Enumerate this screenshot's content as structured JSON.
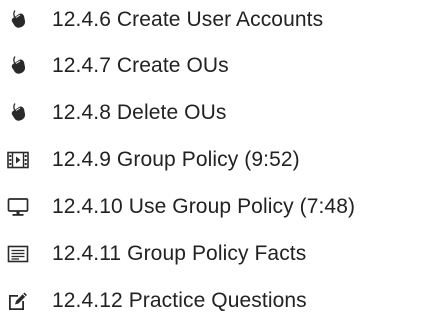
{
  "items": [
    {
      "label": "12.4.6 Create User Accounts",
      "icon": "mouse-icon"
    },
    {
      "label": "12.4.7 Create OUs",
      "icon": "mouse-icon"
    },
    {
      "label": "12.4.8 Delete OUs",
      "icon": "mouse-icon"
    },
    {
      "label": "12.4.9 Group Policy (9:52)",
      "icon": "film-icon"
    },
    {
      "label": "12.4.10 Use Group Policy (7:48)",
      "icon": "monitor-icon"
    },
    {
      "label": "12.4.11 Group Policy Facts",
      "icon": "document-icon"
    },
    {
      "label": "12.4.12 Practice Questions",
      "icon": "edit-icon"
    }
  ],
  "colors": {
    "text": "#222222",
    "icon": "#2a2a2a"
  }
}
